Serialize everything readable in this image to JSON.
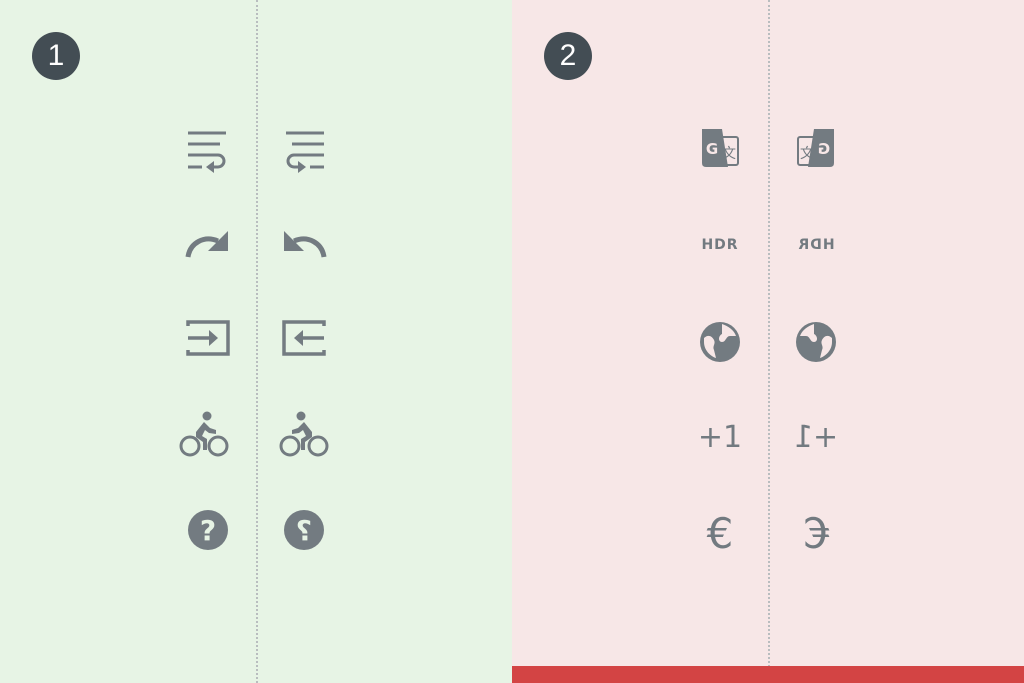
{
  "panels": [
    {
      "number": "1",
      "background": "#e7f4e5"
    },
    {
      "number": "2",
      "background": "#f7e7e7",
      "bottom_bar_color": "#d34444"
    }
  ],
  "icon_color": "#737b81",
  "badge_color": "#434d54",
  "icons": {
    "left": [
      {
        "ltr": "wrap-text-icon",
        "rtl": "wrap-text-mirrored-icon"
      },
      {
        "ltr": "redo-icon",
        "rtl": "undo-icon"
      },
      {
        "ltr": "input-icon",
        "rtl": "input-mirrored-icon"
      },
      {
        "ltr": "bike-icon",
        "rtl": "bike-mirrored-icon"
      },
      {
        "ltr": "help-icon",
        "rtl": "help-mirrored-icon"
      }
    ],
    "right": [
      {
        "ltr": "translate-icon",
        "rtl": "translate-mirrored-icon"
      },
      {
        "ltr": "hdr-icon",
        "rtl": "hdr-mirrored-icon"
      },
      {
        "ltr": "globe-icon",
        "rtl": "globe-mirrored-icon"
      },
      {
        "ltr": "plus-one-icon",
        "rtl": "plus-one-mirrored-icon"
      },
      {
        "ltr": "euro-icon",
        "rtl": "euro-mirrored-icon"
      }
    ]
  },
  "labels": {
    "hdr": "HDR",
    "plus_one": "+1",
    "euro": "€"
  }
}
